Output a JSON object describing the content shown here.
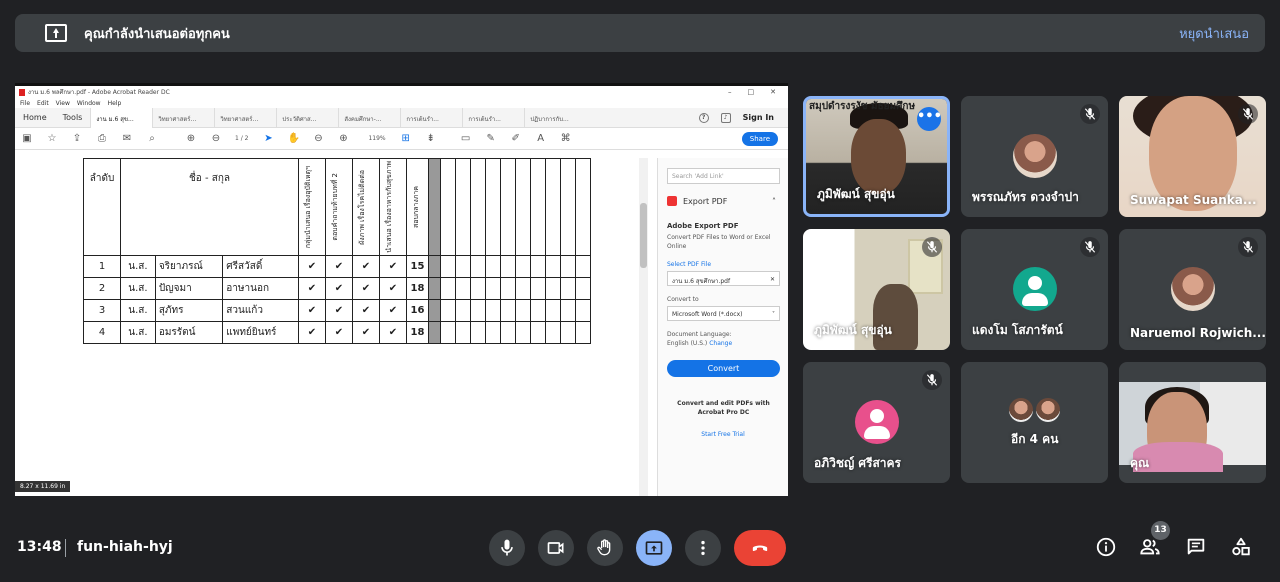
{
  "banner": {
    "message": "คุณกำลังนำเสนอต่อทุกคน",
    "stop_label": "หยุดนำเสนอ"
  },
  "acrobat": {
    "window_title": "งาน ม.6 พลศึกษา.pdf - Adobe Acrobat Reader DC",
    "menu": [
      "File",
      "Edit",
      "View",
      "Window",
      "Help"
    ],
    "home_tab": "Home",
    "tools_tab": "Tools",
    "doc_tabs": [
      "งาน ม.6 สุข...",
      "วิทยาศาสตร์...",
      "วิทยาศาสตร์...",
      "ประวัติศาส...",
      "สังคมศึกษา-...",
      "การเต้นรำ...",
      "การเต้นรำ...",
      "ปฏิบาการกับ..."
    ],
    "sign_in": "Sign In",
    "page_indicator": "1 / 2",
    "zoom": "119%",
    "share_label": "Share",
    "page_size": "8.27 x 11.69 in",
    "table": {
      "col_order": "ลำดับ",
      "col_name": "ชื่อ - สกุล",
      "activity_cols": [
        "กลุ่มนำเสนอ เรื่องอุบัติเหตุฯ",
        "ตอบคำถามท้ายบทที่ 2",
        "ผังภาพ เรื่องโรคไม่ติดต่อ",
        "นำเสนอ เรื่องอาหารกับสุขภาพ"
      ],
      "score_col": "สอบกลางภาค",
      "rows": [
        {
          "no": "1",
          "prefix": "น.ส.",
          "first": "จริยาภรณ์",
          "last": "ศรีสวัสดิ์",
          "checks": [
            "✔",
            "✔",
            "✔",
            "✔"
          ],
          "score": "15"
        },
        {
          "no": "2",
          "prefix": "น.ส.",
          "first": "ปัญจมา",
          "last": "อาษานอก",
          "checks": [
            "✔",
            "✔",
            "✔",
            "✔"
          ],
          "score": "18"
        },
        {
          "no": "3",
          "prefix": "น.ส.",
          "first": "สุภัทร",
          "last": "สวนแก้ว",
          "checks": [
            "✔",
            "✔",
            "✔",
            "✔"
          ],
          "score": "16"
        },
        {
          "no": "4",
          "prefix": "น.ส.",
          "first": "อมรรัตน์",
          "last": "แพทย์ยินทร์",
          "checks": [
            "✔",
            "✔",
            "✔",
            "✔"
          ],
          "score": "18"
        }
      ]
    },
    "panel": {
      "search_placeholder": "Search 'Add Link'",
      "export_title": "Export PDF",
      "adobe_export_heading": "Adobe Export PDF",
      "adobe_export_desc": "Convert PDF Files to Word or Excel Online",
      "select_pdf": "Select PDF File",
      "selected_file": "งาน ม.6 สุขศึกษา.pdf",
      "convert_to_label": "Convert to",
      "convert_to_value": "Microsoft Word (*.docx)",
      "doc_language_label": "Document Language:",
      "doc_language_value": "English (U.S.)",
      "change_link": "Change",
      "convert_button": "Convert",
      "promo": "Convert and edit PDFs with Acrobat Pro DC",
      "trial_link": "Start Free Trial"
    }
  },
  "participants": [
    {
      "name": "ภูมิพัฒน์ สุขอุ่น",
      "muted": false,
      "kind": "video",
      "overlay_text": "สมุปดำรงรงัช มัธยมศึกษ"
    },
    {
      "name": "พรรณภัทร ดวงจำปา",
      "muted": true,
      "kind": "avatar-photo"
    },
    {
      "name": "Suwapat Suanka...",
      "muted": true,
      "kind": "video"
    },
    {
      "name": "ภูมิพัฒน์ สุขอุ่น",
      "muted": true,
      "kind": "video"
    },
    {
      "name": "แดงโม โสภารัตน์",
      "muted": true,
      "kind": "avatar-teal"
    },
    {
      "name": "Naruemol Rojwich...",
      "muted": true,
      "kind": "avatar-photo"
    },
    {
      "name": "อภิวิชญ์ ศรีสาคร",
      "muted": true,
      "kind": "avatar-pink"
    },
    {
      "name": "อีก 4 คน",
      "muted": false,
      "kind": "group"
    },
    {
      "name": "คุณ",
      "muted": false,
      "kind": "video"
    }
  ],
  "bottom_bar": {
    "time": "13:48",
    "meeting_code": "fun-hiah-hyj",
    "people_count": "13"
  },
  "colors": {
    "background": "#202124",
    "tile": "#3c4043",
    "accent_blue": "#8ab4f8",
    "hangup_red": "#ea4335",
    "acrobat_blue": "#1473e6"
  },
  "icons": [
    "present-icon",
    "more-icon",
    "mic-off-icon",
    "mic-icon",
    "camera-icon",
    "hand-icon",
    "present-screen-icon",
    "more-options-icon",
    "hangup-icon",
    "info-icon",
    "people-icon",
    "chat-icon",
    "activities-icon"
  ]
}
